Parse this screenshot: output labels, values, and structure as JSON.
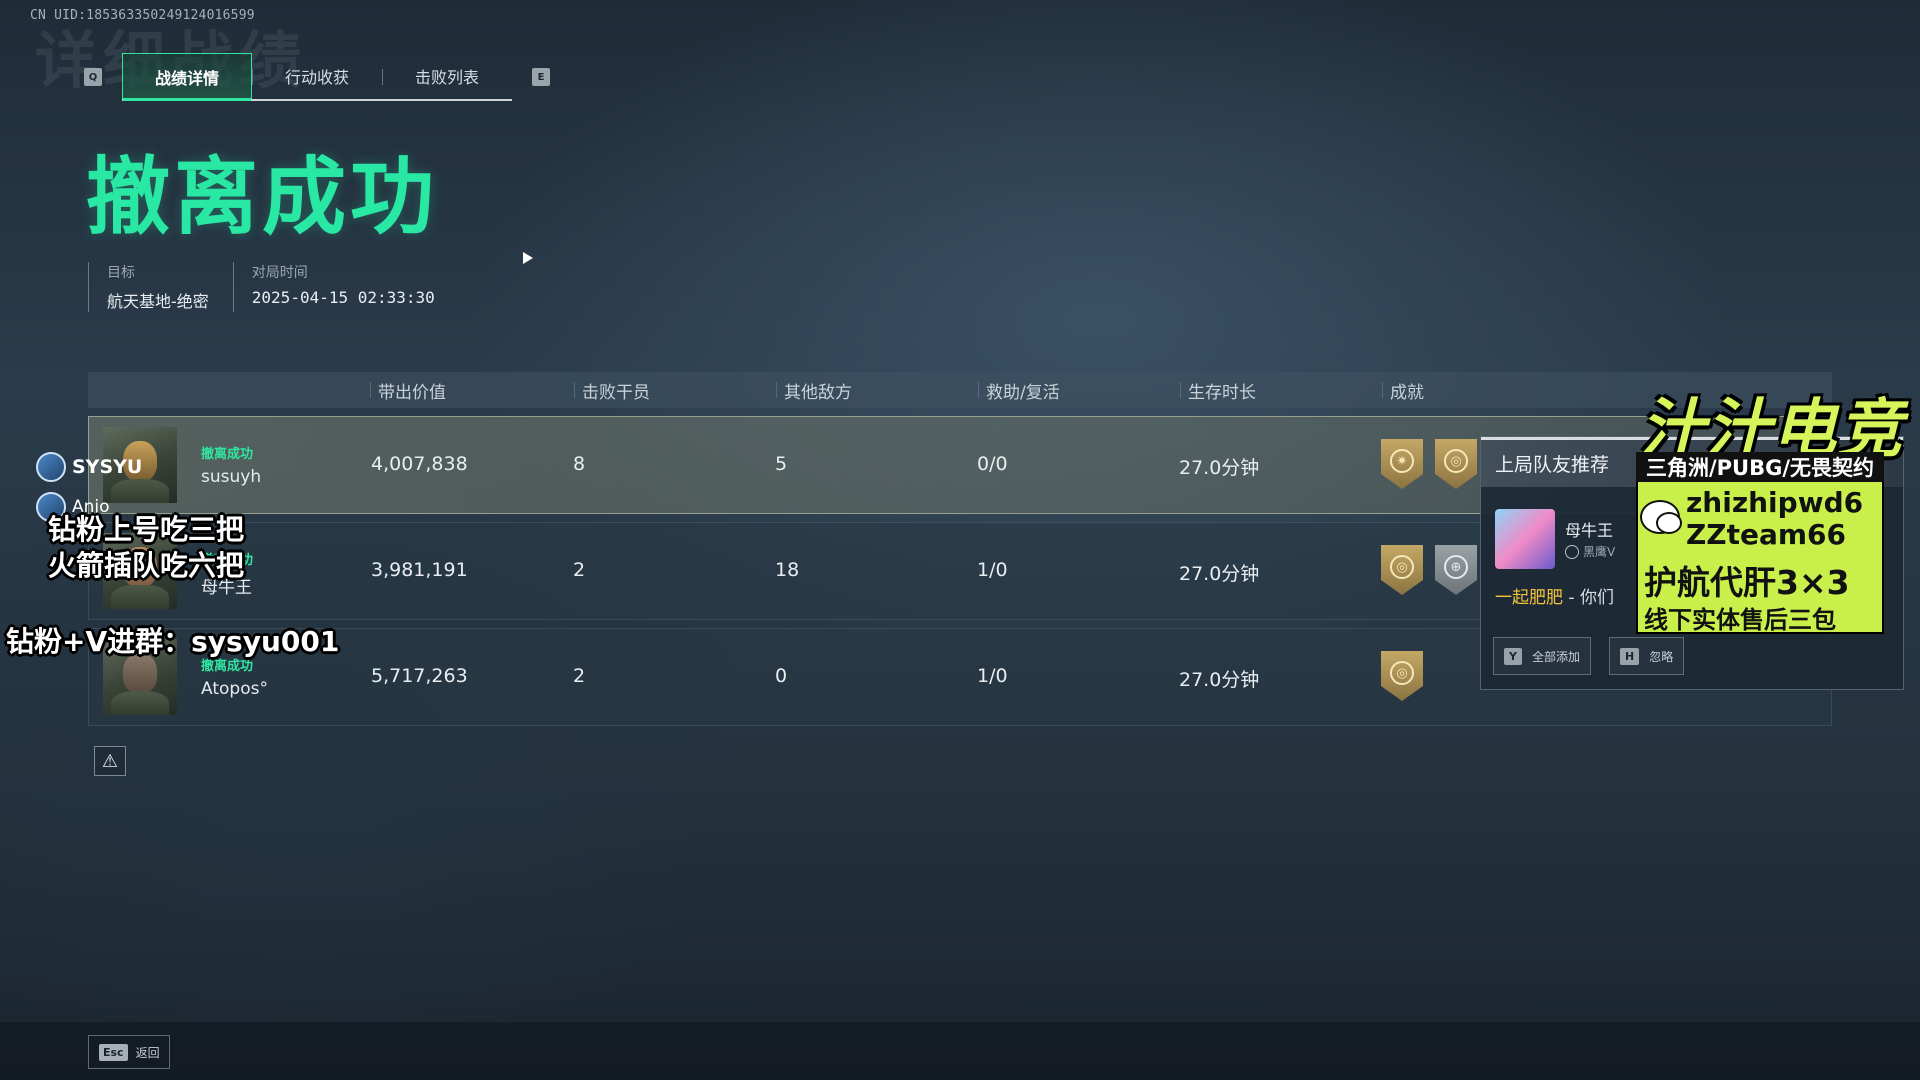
{
  "uid": "CN UID:185363350249124016599",
  "ghost_title": "详细战绩",
  "tabs": {
    "left_key": "Q",
    "right_key": "E",
    "items": [
      "战绩详情",
      "行动收获",
      "击败列表"
    ],
    "active_index": 0
  },
  "result_title": "撤离成功",
  "meta": {
    "target_label": "目标",
    "target_value": "航天基地-绝密",
    "time_label": "对局时间",
    "time_value": "2025-04-15 02:33:30"
  },
  "table": {
    "headers": [
      "带出价值",
      "击败干员",
      "其他敌方",
      "救助/复活",
      "生存时长",
      "成就"
    ],
    "rows": [
      {
        "status": "撤离成功",
        "name": "susuyh",
        "value": "4,007,838",
        "kills": "8",
        "others": "5",
        "assist": "0/0",
        "survival": "27.0分钟",
        "badges": [
          "sun-medal-icon",
          "coin-medal-icon"
        ]
      },
      {
        "status": "撤离成功",
        "name": "母牛王",
        "value": "3,981,191",
        "kills": "2",
        "others": "18",
        "assist": "1/0",
        "survival": "27.0分钟",
        "badges": [
          "coin-medal-icon",
          "crosshair-medal-icon"
        ]
      },
      {
        "status": "撤离成功",
        "name": "Atopos°",
        "value": "5,717,263",
        "kills": "2",
        "others": "0",
        "assist": "1/0",
        "survival": "27.0分钟",
        "badges": [
          "coin-medal-icon"
        ]
      }
    ]
  },
  "popup": {
    "title": "上局队友推荐",
    "player_name": "母牛王",
    "player_rank": "黑鹰V",
    "message_highlight": "一起肥肥",
    "message_rest": " - 你们",
    "add_all_key": "Y",
    "add_all_label": "全部添加",
    "ignore_key": "H",
    "ignore_label": "忽略"
  },
  "footer": {
    "esc_key": "Esc",
    "esc_label": "返回"
  },
  "stream_overlay": {
    "streamer_name": "SYSYU",
    "second_name": "Anjo",
    "line1": "钻粉上号吃三把",
    "line2": "火箭插队吃六把",
    "line3": "钻粉+V进群：sysyu001",
    "brand": "汁汁电竞",
    "ad_top": "三角洲/PUBG/无畏契约",
    "ad_id1": "zhizhipwd6",
    "ad_id2": "ZZteam66",
    "ad_service": "护航代肝3×3",
    "ad_after": "线下实体售后三包"
  },
  "colors": {
    "accent": "#28e8a4",
    "highlight_text": "#f2c33b",
    "ad_bg": "#c9f04a"
  }
}
